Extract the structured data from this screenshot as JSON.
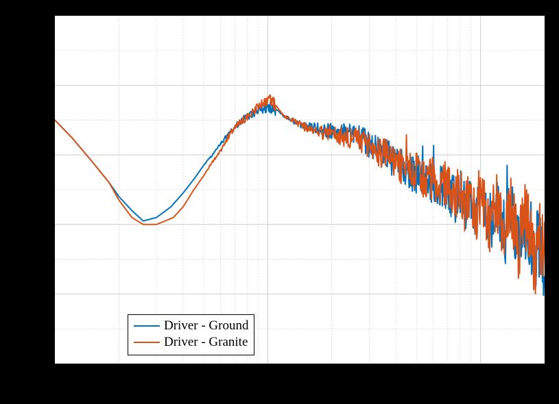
{
  "chart_data": {
    "type": "line",
    "xscale": "log",
    "xlim": [
      10,
      2000
    ],
    "ylim": [
      -80,
      20
    ],
    "legend_position": "lower-left",
    "series": [
      {
        "name": "Driver - Ground",
        "color": "#0072BD",
        "x": [
          10,
          12,
          15,
          18,
          20,
          23,
          26,
          30,
          35,
          40,
          45,
          50,
          55,
          60,
          65,
          70,
          80,
          90,
          100,
          110,
          120,
          130,
          140,
          150,
          170,
          190,
          210,
          230,
          250,
          270,
          300,
          330,
          360,
          400,
          440,
          480,
          520,
          560,
          600,
          650,
          700,
          750,
          800,
          850,
          900,
          950,
          1000,
          1100,
          1200,
          1300,
          1400,
          1500,
          1600,
          1700,
          1800,
          1900,
          2000
        ],
        "y": [
          -10,
          -15,
          -22,
          -28,
          -32,
          -36,
          -39,
          -38,
          -35,
          -31,
          -27,
          -23,
          -20,
          -17,
          -14,
          -12,
          -9,
          -7,
          -6,
          -7,
          -9,
          -10,
          -11,
          -12,
          -12,
          -13,
          -13,
          -14,
          -14,
          -15,
          -17,
          -18,
          -20,
          -22,
          -24,
          -26,
          -25,
          -28,
          -27,
          -30,
          -28,
          -33,
          -30,
          -35,
          -32,
          -38,
          -33,
          -40,
          -35,
          -43,
          -36,
          -45,
          -40,
          -42,
          -48,
          -45,
          -60
        ]
      },
      {
        "name": "Driver - Granite",
        "color": "#D95319",
        "x": [
          10,
          12,
          15,
          18,
          20,
          23,
          26,
          30,
          33,
          36,
          40,
          45,
          50,
          55,
          60,
          65,
          70,
          80,
          90,
          100,
          110,
          120,
          130,
          140,
          150,
          170,
          190,
          210,
          230,
          250,
          270,
          300,
          330,
          360,
          400,
          440,
          480,
          520,
          560,
          600,
          650,
          700,
          750,
          800,
          850,
          900,
          950,
          1000,
          1100,
          1200,
          1300,
          1400,
          1500,
          1600,
          1700,
          1800,
          1900,
          2000
        ],
        "y": [
          -10,
          -15,
          -22,
          -28,
          -33,
          -38,
          -40,
          -40,
          -39,
          -38,
          -35,
          -30,
          -26,
          -22,
          -19,
          -15,
          -12,
          -9,
          -6,
          -4,
          -6,
          -9,
          -10,
          -11,
          -12,
          -13,
          -14,
          -14,
          -15,
          -15,
          -16,
          -17,
          -19,
          -20,
          -22,
          -24,
          -25,
          -24,
          -29,
          -26,
          -31,
          -27,
          -34,
          -29,
          -36,
          -30,
          -39,
          -31,
          -41,
          -33,
          -44,
          -35,
          -47,
          -38,
          -42,
          -50,
          -43,
          -48
        ]
      }
    ],
    "legend": [
      "Driver - Ground",
      "Driver - Granite"
    ],
    "xticks_major": [
      10,
      100,
      1000
    ],
    "xticks_minor": [
      20,
      30,
      40,
      50,
      60,
      70,
      80,
      90,
      200,
      300,
      400,
      500,
      600,
      700,
      800,
      900,
      2000
    ],
    "yticks_major": [
      -80,
      -60,
      -40,
      -20,
      0,
      20
    ],
    "yticks_minor": [
      -70,
      -50,
      -30,
      -10,
      10
    ]
  },
  "colors": {
    "series1": "#0072BD",
    "series2": "#D95319"
  },
  "legend": {
    "items": [
      {
        "label": "Driver - Ground"
      },
      {
        "label": "Driver - Granite"
      }
    ]
  }
}
